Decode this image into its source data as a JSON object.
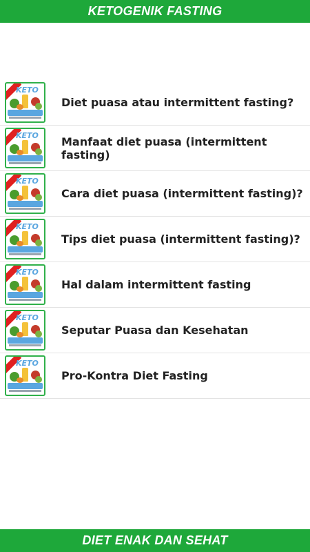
{
  "header": {
    "title": "KETOGENIK FASTING"
  },
  "footer": {
    "title": "DIET ENAK DAN SEHAT"
  },
  "list": {
    "items": [
      {
        "label": "Diet puasa atau intermittent fasting?"
      },
      {
        "label": "Manfaat diet puasa (intermittent fasting)"
      },
      {
        "label": "Cara diet puasa (intermittent fasting)?"
      },
      {
        "label": "Tips diet puasa (intermittent fasting)?"
      },
      {
        "label": "Hal dalam intermittent fasting"
      },
      {
        "label": "Seputar Puasa dan Kesehatan"
      },
      {
        "label": "Pro-Kontra Diet Fasting"
      }
    ],
    "thumbnail_icon": "keto-fasting-thumbnail-icon"
  },
  "colors": {
    "brand_green": "#1ea83a",
    "text": "#222222"
  }
}
